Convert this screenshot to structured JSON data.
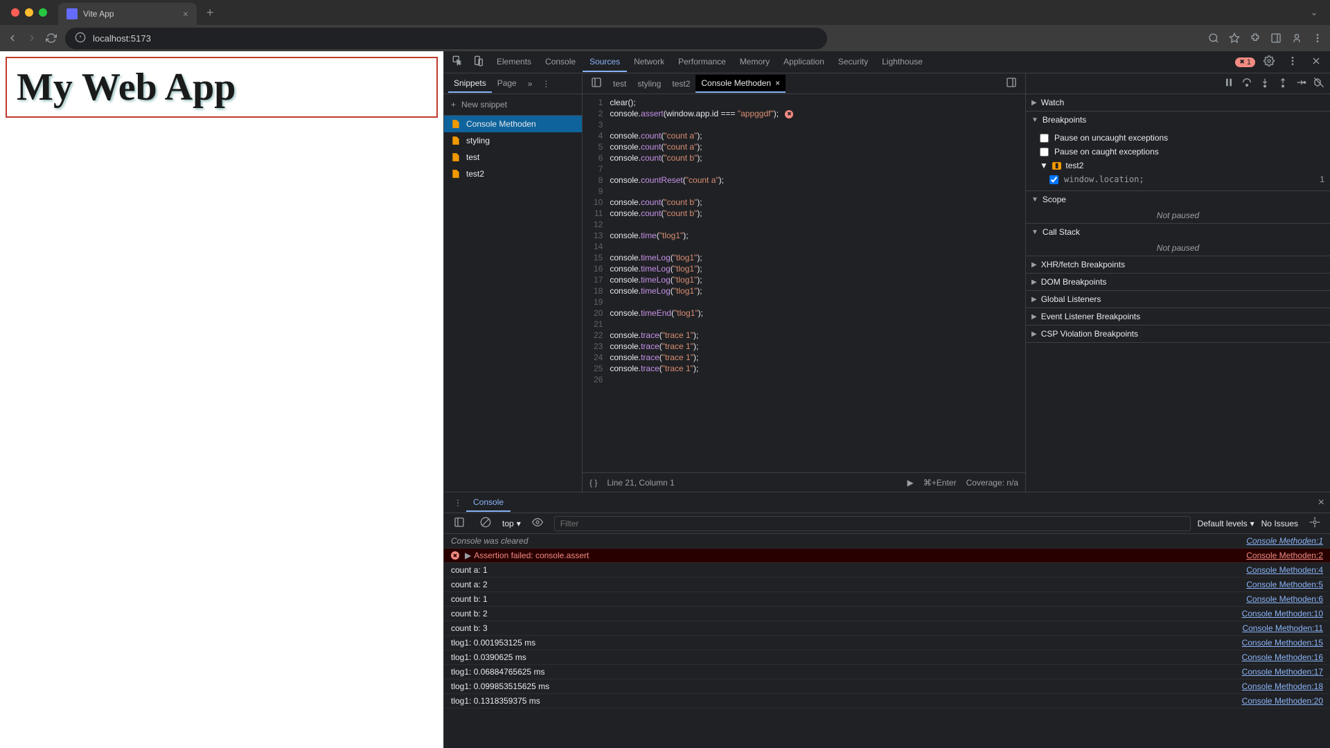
{
  "browser": {
    "tab_title": "Vite App",
    "url": "localhost:5173"
  },
  "page": {
    "heading": "My Web App"
  },
  "devtools": {
    "tabs": [
      "Elements",
      "Console",
      "Sources",
      "Network",
      "Performance",
      "Memory",
      "Application",
      "Security",
      "Lighthouse"
    ],
    "active_tab": "Sources",
    "error_count": "1"
  },
  "sources": {
    "sub_tabs": [
      "Snippets",
      "Page"
    ],
    "active_sub": "Snippets",
    "new_snippet_label": "New snippet",
    "snippets": [
      "Console Methoden",
      "styling",
      "test",
      "test2"
    ],
    "active_snippet": "Console Methoden",
    "open_files": [
      "test",
      "styling",
      "test2",
      "Console Methoden"
    ],
    "active_file": "Console Methoden",
    "status_line": "Line 21, Column 1",
    "run_hint": "⌘+Enter",
    "coverage": "Coverage: n/a"
  },
  "code_lines": [
    {
      "n": 1,
      "html": "clear();"
    },
    {
      "n": 2,
      "html": "console.<span class='tk-fn'>assert</span>(window.app.id <span class='tk-op'>===</span> <span class='tk-str'>\"appggdf\"</span>);",
      "err": true
    },
    {
      "n": 3,
      "html": ""
    },
    {
      "n": 4,
      "html": "console.<span class='tk-fn'>count</span>(<span class='tk-str'>\"count a\"</span>);"
    },
    {
      "n": 5,
      "html": "console.<span class='tk-fn'>count</span>(<span class='tk-str'>\"count a\"</span>);"
    },
    {
      "n": 6,
      "html": "console.<span class='tk-fn'>count</span>(<span class='tk-str'>\"count b\"</span>);"
    },
    {
      "n": 7,
      "html": ""
    },
    {
      "n": 8,
      "html": "console.<span class='tk-fn'>countReset</span>(<span class='tk-str'>\"count a\"</span>);"
    },
    {
      "n": 9,
      "html": ""
    },
    {
      "n": 10,
      "html": "console.<span class='tk-fn'>count</span>(<span class='tk-str'>\"count b\"</span>);"
    },
    {
      "n": 11,
      "html": "console.<span class='tk-fn'>count</span>(<span class='tk-str'>\"count b\"</span>);"
    },
    {
      "n": 12,
      "html": ""
    },
    {
      "n": 13,
      "html": "console.<span class='tk-fn'>time</span>(<span class='tk-str'>\"tlog1\"</span>);"
    },
    {
      "n": 14,
      "html": ""
    },
    {
      "n": 15,
      "html": "console.<span class='tk-fn'>timeLog</span>(<span class='tk-str'>\"tlog1\"</span>);"
    },
    {
      "n": 16,
      "html": "console.<span class='tk-fn'>timeLog</span>(<span class='tk-str'>\"tlog1\"</span>);"
    },
    {
      "n": 17,
      "html": "console.<span class='tk-fn'>timeLog</span>(<span class='tk-str'>\"tlog1\"</span>);"
    },
    {
      "n": 18,
      "html": "console.<span class='tk-fn'>timeLog</span>(<span class='tk-str'>\"tlog1\"</span>);"
    },
    {
      "n": 19,
      "html": ""
    },
    {
      "n": 20,
      "html": "console.<span class='tk-fn'>timeEnd</span>(<span class='tk-str'>\"tlog1\"</span>);"
    },
    {
      "n": 21,
      "html": ""
    },
    {
      "n": 22,
      "html": "console.<span class='tk-fn'>trace</span>(<span class='tk-str'>\"trace 1\"</span>);"
    },
    {
      "n": 23,
      "html": "console.<span class='tk-fn'>trace</span>(<span class='tk-str'>\"trace 1\"</span>);"
    },
    {
      "n": 24,
      "html": "console.<span class='tk-fn'>trace</span>(<span class='tk-str'>\"trace 1\"</span>);"
    },
    {
      "n": 25,
      "html": "console.<span class='tk-fn'>trace</span>(<span class='tk-str'>\"trace 1\"</span>);"
    },
    {
      "n": 26,
      "html": ""
    }
  ],
  "debugger": {
    "watch": "Watch",
    "breakpoints": "Breakpoints",
    "pause_uncaught": "Pause on uncaught exceptions",
    "pause_caught": "Pause on caught exceptions",
    "bp_group": "test2",
    "bp_item_code": "window.location;",
    "bp_item_line": "1",
    "scope": "Scope",
    "call_stack": "Call Stack",
    "not_paused": "Not paused",
    "xhr": "XHR/fetch Breakpoints",
    "dom": "DOM Breakpoints",
    "global": "Global Listeners",
    "event": "Event Listener Breakpoints",
    "csp": "CSP Violation Breakpoints"
  },
  "console": {
    "tab": "Console",
    "context": "top",
    "filter_placeholder": "Filter",
    "levels": "Default levels",
    "issues": "No Issues",
    "logs": [
      {
        "type": "info",
        "msg": "Console was cleared",
        "src": "Console Methoden:1"
      },
      {
        "type": "error",
        "msg": "Assertion failed: console.assert",
        "src": "Console Methoden:2",
        "expand": true
      },
      {
        "type": "log",
        "msg": "count a: 1",
        "src": "Console Methoden:4"
      },
      {
        "type": "log",
        "msg": "count a: 2",
        "src": "Console Methoden:5"
      },
      {
        "type": "log",
        "msg": "count b: 1",
        "src": "Console Methoden:6"
      },
      {
        "type": "log",
        "msg": "count b: 2",
        "src": "Console Methoden:10"
      },
      {
        "type": "log",
        "msg": "count b: 3",
        "src": "Console Methoden:11"
      },
      {
        "type": "log",
        "msg": "tlog1: 0.001953125 ms",
        "src": "Console Methoden:15"
      },
      {
        "type": "log",
        "msg": "tlog1: 0.0390625 ms",
        "src": "Console Methoden:16"
      },
      {
        "type": "log",
        "msg": "tlog1: 0.06884765625 ms",
        "src": "Console Methoden:17"
      },
      {
        "type": "log",
        "msg": "tlog1: 0.099853515625 ms",
        "src": "Console Methoden:18"
      },
      {
        "type": "log",
        "msg": "tlog1: 0.1318359375 ms",
        "src": "Console Methoden:20"
      }
    ]
  }
}
